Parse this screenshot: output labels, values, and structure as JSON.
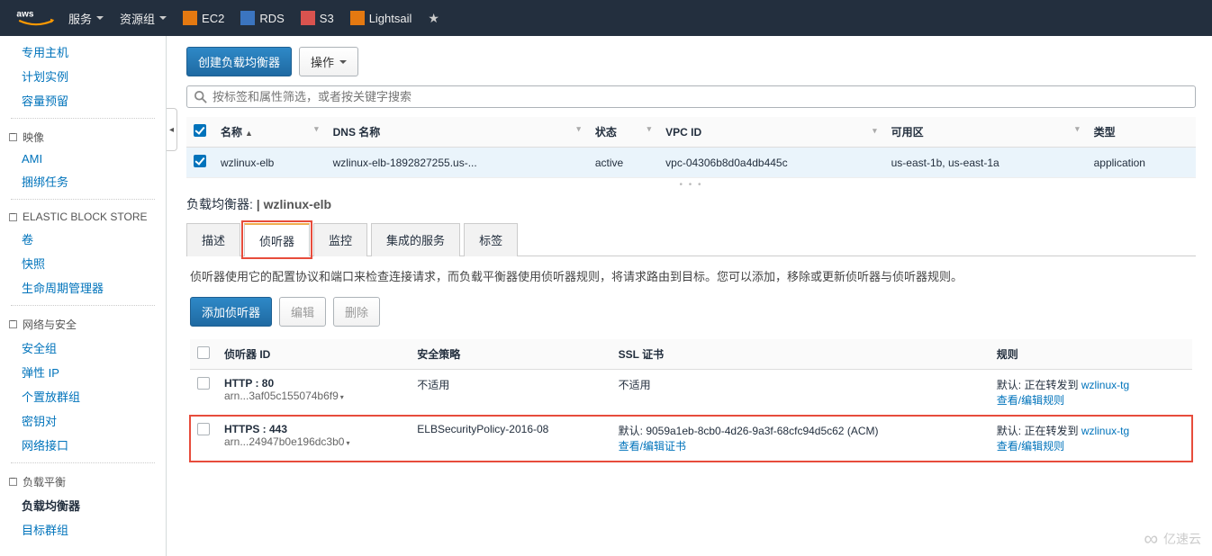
{
  "topnav": {
    "services": "服务",
    "resource_groups": "资源组",
    "items": [
      {
        "label": "EC2",
        "color": "#e47911"
      },
      {
        "label": "RDS",
        "color": "#3b75c0"
      },
      {
        "label": "S3",
        "color": "#d9534f"
      },
      {
        "label": "Lightsail",
        "color": "#e47911"
      }
    ]
  },
  "sidebar": {
    "top": [
      "专用主机",
      "计划实例",
      "容量预留"
    ],
    "g_image": {
      "head": "映像",
      "items": [
        "AMI",
        "捆绑任务"
      ]
    },
    "g_ebs": {
      "head": "ELASTIC BLOCK STORE",
      "items": [
        "卷",
        "快照",
        "生命周期管理器"
      ]
    },
    "g_net": {
      "head": "网络与安全",
      "items": [
        "安全组",
        "弹性 IP",
        "个置放群组",
        "密钥对",
        "网络接口"
      ]
    },
    "g_lb": {
      "head": "负载平衡",
      "items": [
        "负载均衡器",
        "目标群组"
      ],
      "active": 0
    }
  },
  "toolbar": {
    "create": "创建负载均衡器",
    "actions": "操作",
    "search_placeholder": "按标签和属性筛选，或者按关键字搜索"
  },
  "lb_table": {
    "headers": [
      "名称",
      "DNS 名称",
      "状态",
      "VPC ID",
      "可用区",
      "类型"
    ],
    "row": {
      "name": "wzlinux-elb",
      "dns": "wzlinux-elb-1892827255.us-...",
      "state": "active",
      "vpc": "vpc-04306b8d0a4db445c",
      "az": "us-east-1b, us-east-1a",
      "type": "application"
    }
  },
  "panel": {
    "title_label": "负载均衡器:",
    "title_value": "wzlinux-elb",
    "tabs": [
      "描述",
      "侦听器",
      "监控",
      "集成的服务",
      "标签"
    ],
    "active_tab": 1,
    "desc": "侦听器使用它的配置协议和端口来检查连接请求，而负载平衡器使用侦听器规则，将请求路由到目标。您可以添加，移除或更新侦听器与侦听器规则。",
    "buttons": {
      "add": "添加侦听器",
      "edit": "编辑",
      "delete": "删除"
    }
  },
  "listeners": {
    "headers": [
      "侦听器 ID",
      "安全策略",
      "SSL 证书",
      "规则"
    ],
    "rows": [
      {
        "proto": "HTTP : 80",
        "arn": "arn...3af05c155074b6f9",
        "policy": "不适用",
        "ssl": "不适用",
        "ssl_link": "",
        "rule_prefix": "默认:",
        "rule_action": "正在转发到",
        "rule_target": "wzlinux-tg",
        "rule_link": "查看/编辑规则"
      },
      {
        "proto": "HTTPS : 443",
        "arn": "arn...24947b0e196dc3b0",
        "policy": "ELBSecurityPolicy-2016-08",
        "ssl_prefix": "默认:",
        "ssl": "9059a1eb-8cb0-4d26-9a3f-68cfc94d5c62 (ACM)",
        "ssl_link": "查看/编辑证书",
        "rule_prefix": "默认:",
        "rule_action": "正在转发到",
        "rule_target": "wzlinux-tg",
        "rule_link": "查看/编辑规则"
      }
    ]
  },
  "watermark": "亿速云"
}
